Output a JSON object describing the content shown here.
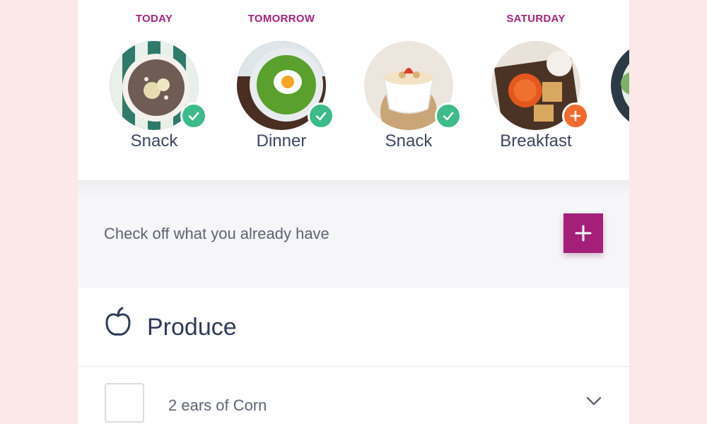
{
  "meals": [
    {
      "day": "TODAY",
      "name": "Snack",
      "status": "done",
      "image": "chia-pudding-bowl"
    },
    {
      "day": "TOMORROW",
      "name": "Dinner",
      "status": "done",
      "image": "green-soup-with-egg"
    },
    {
      "day": "",
      "name": "Snack",
      "status": "done",
      "image": "yogurt-cup-with-strawberry"
    },
    {
      "day": "SATURDAY",
      "name": "Breakfast",
      "status": "add",
      "image": "crackers-and-tomato-spread"
    }
  ],
  "checkoff": {
    "hint": "Check off what you already have",
    "add_icon": "plus-icon"
  },
  "section": {
    "title": "Produce",
    "icon": "apple-icon"
  },
  "items": [
    {
      "label": "2 ears of Corn",
      "checked": false
    }
  ],
  "colors": {
    "accent": "#a31f7a",
    "day_label": "#a3237a",
    "done_badge": "#3dbb8a",
    "add_badge": "#f26b2e",
    "background": "#fce8e8"
  }
}
